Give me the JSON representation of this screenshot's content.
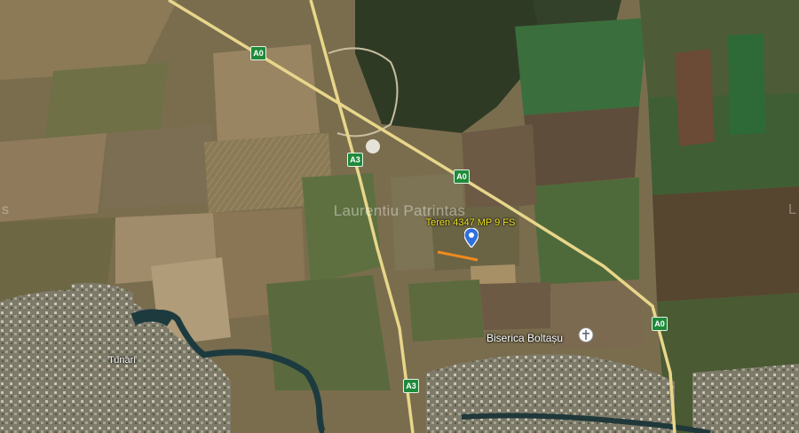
{
  "watermark": "Laurentiu Patrintas",
  "edge_marks": {
    "left": "s",
    "right": "L"
  },
  "property": {
    "label": "Teren 4347 MP 9 FS",
    "marker_color": "#2f6fe0",
    "boundary_color": "#f08a1e"
  },
  "roads": [
    {
      "id": "a0-top",
      "name": "A0"
    },
    {
      "id": "a3-mid",
      "name": "A3"
    },
    {
      "id": "a0-mid",
      "name": "A0"
    },
    {
      "id": "a0-right",
      "name": "A0"
    },
    {
      "id": "a3-bottom",
      "name": "A3"
    }
  ],
  "places": {
    "town": "Tunari",
    "church": "Biserica Boltașu"
  },
  "colors": {
    "road_shield": "#1f8a3a",
    "highway": "#e8d68a"
  }
}
